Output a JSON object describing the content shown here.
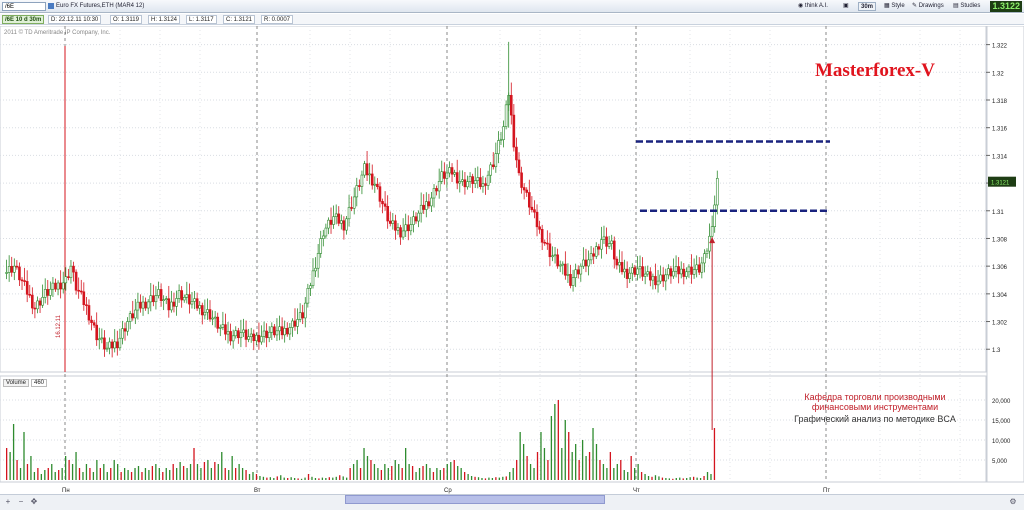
{
  "toolbar": {
    "symbol": "/6E",
    "description": "Euro FX Futures,ETH (MAR4 12)",
    "buttons": {
      "think": "think A.I.",
      "interval": "30m",
      "style": "Style",
      "drawings": "Drawings",
      "studies": "Studies"
    },
    "last_price": "1.3122"
  },
  "infobar": {
    "period": "/6E 10 d 30m",
    "date": "D: 22.12.11 10:30",
    "open": "O: 1.3119",
    "high": "H: 1.3124",
    "low": "L: 1.3117",
    "close": "C: 1.3121",
    "range": "R: 0.0007"
  },
  "copyright": "2011 © TD Ameritrade IP Company, Inc.",
  "brand": "Masterforex-V",
  "notes": {
    "line1": "Кафедра торговли производными финансовыми инструментами",
    "line2": "Графический анализ по методике BCA"
  },
  "date_marker": "16.12.11",
  "volume_panel": {
    "label": "Volume",
    "count": "460"
  },
  "price_axis_label": "1.3121",
  "colors": {
    "up": "#2e8b2e",
    "down": "#d4141e",
    "level_line": "#1a237e",
    "arrow": "#c0202a",
    "brand": "#e0141e"
  },
  "chart_data": {
    "type": "candlestick",
    "x_ticks": [
      "Пн",
      "Вт",
      "Ср",
      "Чт",
      "Пт"
    ],
    "y_ticks": [
      "1.322",
      "1.32",
      "1.318",
      "1.316",
      "1.314",
      "1.312",
      "1.31",
      "1.308",
      "1.306",
      "1.304",
      "1.302",
      "1.3"
    ],
    "ylim": [
      1.2985,
      1.3232
    ],
    "volume_ticks": [
      "20,000",
      "15,000",
      "10,000",
      "5,000"
    ],
    "volume_ylim": [
      0,
      22000
    ],
    "levels": [
      1.315,
      1.31
    ],
    "close_path": [
      [
        0,
        1.3055
      ],
      [
        4,
        1.306
      ],
      [
        8,
        1.3045
      ],
      [
        12,
        1.303
      ],
      [
        16,
        1.304
      ],
      [
        20,
        1.3045
      ],
      [
        24,
        1.305
      ],
      [
        26,
        1.306
      ],
      [
        28,
        1.3045
      ],
      [
        32,
        1.303
      ],
      [
        36,
        1.301
      ],
      [
        40,
        1.3
      ],
      [
        44,
        1.3005
      ],
      [
        48,
        1.302
      ],
      [
        52,
        1.303
      ],
      [
        56,
        1.3035
      ],
      [
        60,
        1.304
      ],
      [
        64,
        1.303
      ],
      [
        68,
        1.304
      ],
      [
        72,
        1.3035
      ],
      [
        76,
        1.303
      ],
      [
        80,
        1.3025
      ],
      [
        84,
        1.3015
      ],
      [
        88,
        1.301
      ],
      [
        92,
        1.3012
      ],
      [
        96,
        1.3007
      ],
      [
        100,
        1.301
      ],
      [
        104,
        1.3013
      ],
      [
        108,
        1.3012
      ],
      [
        112,
        1.3018
      ],
      [
        116,
        1.3025
      ],
      [
        120,
        1.3055
      ],
      [
        124,
        1.3085
      ],
      [
        128,
        1.3095
      ],
      [
        132,
        1.309
      ],
      [
        136,
        1.311
      ],
      [
        140,
        1.313
      ],
      [
        144,
        1.312
      ],
      [
        148,
        1.31
      ],
      [
        150,
        1.309
      ],
      [
        154,
        1.3085
      ],
      [
        158,
        1.309
      ],
      [
        162,
        1.31
      ],
      [
        166,
        1.311
      ],
      [
        170,
        1.3125
      ],
      [
        174,
        1.3128
      ],
      [
        178,
        1.312
      ],
      [
        182,
        1.3122
      ],
      [
        186,
        1.3118
      ],
      [
        190,
        1.3135
      ],
      [
        194,
        1.316
      ],
      [
        196,
        1.3185
      ],
      [
        198,
        1.315
      ],
      [
        200,
        1.3125
      ],
      [
        204,
        1.3105
      ],
      [
        208,
        1.3085
      ],
      [
        212,
        1.307
      ],
      [
        216,
        1.306
      ],
      [
        220,
        1.305
      ],
      [
        224,
        1.306
      ],
      [
        228,
        1.3065
      ],
      [
        232,
        1.308
      ],
      [
        236,
        1.3075
      ],
      [
        238,
        1.306
      ],
      [
        242,
        1.3055
      ],
      [
        246,
        1.3058
      ],
      [
        250,
        1.3052
      ],
      [
        254,
        1.305
      ],
      [
        258,
        1.3055
      ],
      [
        262,
        1.3056
      ],
      [
        266,
        1.3057
      ],
      [
        270,
        1.3058
      ],
      [
        272,
        1.3065
      ],
      [
        274,
        1.308
      ],
      [
        276,
        1.3105
      ],
      [
        277,
        1.3121
      ]
    ],
    "volume": [
      8000,
      7000,
      14000,
      5000,
      3000,
      12000,
      4000,
      6000,
      2000,
      3000,
      1500,
      2500,
      3000,
      4000,
      2000,
      2500,
      3000,
      6000,
      5000,
      4000,
      7000,
      3000,
      2000,
      4000,
      3000,
      2000,
      5000,
      3000,
      4000,
      2000,
      3000,
      5000,
      4000,
      2000,
      3000,
      2500,
      2000,
      3000,
      3500,
      2000,
      3000,
      2500,
      3500,
      4000,
      3000,
      2000,
      3000,
      2500,
      4000,
      3000,
      4500,
      3500,
      3000,
      4000,
      8000,
      4000,
      3000,
      4500,
      5000,
      3000,
      4500,
      4000,
      7000,
      3000,
      2500,
      6000,
      3000,
      4000,
      3000,
      2500,
      1500,
      2000,
      1500,
      1000,
      800,
      600,
      700,
      500,
      900,
      1200,
      600,
      500,
      700,
      500,
      400,
      300,
      600,
      1500,
      800,
      500,
      400,
      600,
      500,
      700,
      600,
      800,
      1200,
      900,
      600,
      3000,
      4000,
      5000,
      3000,
      8000,
      6000,
      5000,
      4000,
      3000,
      2500,
      4000,
      3000,
      3500,
      5000,
      4000,
      3000,
      8000,
      4000,
      3500,
      2000,
      3000,
      3500,
      4000,
      3000,
      2000,
      3000,
      2500,
      3000,
      4000,
      4500,
      5000,
      3500,
      3000,
      2000,
      1500,
      1000,
      800,
      700,
      500,
      400,
      600,
      500,
      700,
      600,
      800,
      900,
      2000,
      3000,
      5000,
      12000,
      9000,
      6000,
      4000,
      3000,
      7000,
      12000,
      8000,
      5000,
      16000,
      19000,
      20000,
      8000,
      15000,
      12000,
      7000,
      9000,
      5000,
      10000,
      6000,
      7000,
      13000,
      9000,
      5000,
      4000,
      3000,
      7000,
      3000,
      4000,
      5000,
      2500,
      2000,
      6000,
      3000,
      4000,
      2000,
      1500,
      1000,
      800,
      1200,
      900,
      600,
      500,
      400,
      300,
      500,
      600,
      400,
      500,
      700,
      800,
      600,
      500,
      1000,
      2000,
      1500,
      13000
    ]
  }
}
